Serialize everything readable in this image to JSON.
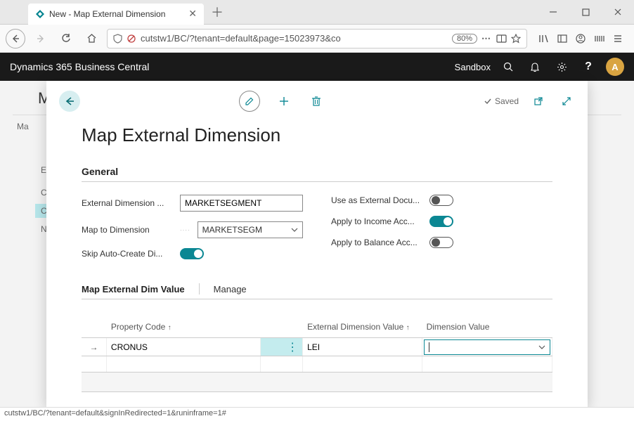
{
  "browser": {
    "tab_title": "New - Map External Dimension",
    "url": "cutstw1/BC/?tenant=default&page=15023973&co",
    "zoom": "80%",
    "status_bar": "cutstw1/BC/?tenant=default&signInRedirected=1&runinframe=1#"
  },
  "header": {
    "brand": "Dynamics 365 Business Central",
    "environment": "Sandbox",
    "avatar_initial": "A"
  },
  "card": {
    "title": "Map External Dimension",
    "saved_label": "Saved",
    "section_general": "General",
    "fields": {
      "ext_dim_label": "External Dimension ...",
      "ext_dim_value": "MARKETSEGMENT",
      "map_to_label": "Map to Dimension",
      "map_to_value": "MARKETSEGM",
      "skip_auto_label": "Skip Auto-Create Di...",
      "use_ext_label": "Use as External Docu...",
      "apply_income_label": "Apply to Income Acc...",
      "apply_balance_label": "Apply to Balance Acc..."
    },
    "sub": {
      "title": "Map External Dim Value",
      "manage": "Manage"
    },
    "table": {
      "col_prop": "Property Code",
      "col_ext": "External Dimension Value",
      "col_dim": "Dimension Value",
      "row1_prop": "CRONUS",
      "row1_ext": "LEI",
      "row1_dim": ""
    }
  },
  "bg": {
    "m1": "M",
    "m2": "Ma",
    "e": "E",
    "c1": "C",
    "c2": "C",
    "n": "N"
  }
}
